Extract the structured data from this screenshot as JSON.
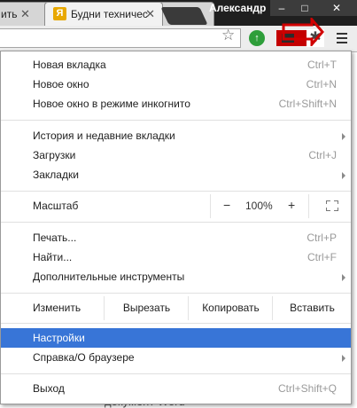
{
  "tabs": [
    {
      "label": "ить",
      "close": "✕"
    },
    {
      "label": "Будни техничес",
      "close": "✕",
      "favicon": "yandex-icon"
    }
  ],
  "window": {
    "profile_name": "Александр",
    "minimize": "–",
    "maximize": "□",
    "close": "✕"
  },
  "toolbar": {
    "star_icon": "☆",
    "ext_green_icon": "↑",
    "ext_star_icon": "✱"
  },
  "menu": {
    "group1": [
      {
        "label": "Новая вкладка",
        "shortcut": "Ctrl+T"
      },
      {
        "label": "Новое окно",
        "shortcut": "Ctrl+N"
      },
      {
        "label": "Новое окно в режиме инкогнито",
        "shortcut": "Ctrl+Shift+N"
      }
    ],
    "group2": [
      {
        "label": "История и недавние вкладки",
        "submenu": true
      },
      {
        "label": "Загрузки",
        "shortcut": "Ctrl+J"
      },
      {
        "label": "Закладки",
        "submenu": true
      }
    ],
    "zoom": {
      "label": "Масштаб",
      "minus": "−",
      "value": "100%",
      "plus": "+"
    },
    "group3": [
      {
        "label": "Печать...",
        "shortcut": "Ctrl+P"
      },
      {
        "label": "Найти...",
        "shortcut": "Ctrl+F"
      },
      {
        "label": "Дополнительные инструменты",
        "submenu": true
      }
    ],
    "edit": {
      "label": "Изменить",
      "cut": "Вырезать",
      "copy": "Копировать",
      "paste": "Вставить"
    },
    "group4": [
      {
        "label": "Настройки",
        "highlighted": true
      },
      {
        "label": "Справка/О браузере",
        "submenu": true
      }
    ],
    "exit": {
      "label": "Выход",
      "shortcut": "Ctrl+Shift+Q"
    }
  },
  "background_text": "документ Word",
  "colors": {
    "highlight": "#3875d7",
    "annotation_red": "#d00000"
  }
}
